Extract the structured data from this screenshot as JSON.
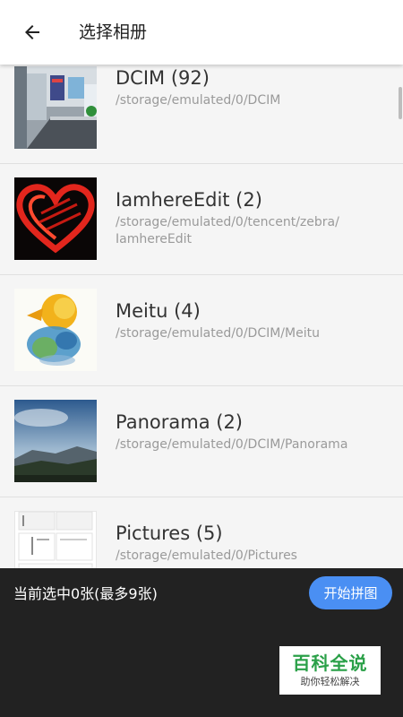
{
  "appbar": {
    "back_icon": "arrow-back-icon",
    "title": "选择相册"
  },
  "albums": [
    {
      "name": "DCIM (92)",
      "path": "/storage/emulated/0/DCIM",
      "thumb": "office-photo"
    },
    {
      "name": "IamhereEdit (2)",
      "path": "/storage/emulated/0/tencent/zebra/\nIamhereEdit",
      "thumb": "red-heart-image"
    },
    {
      "name": "Meitu (4)",
      "path": "/storage/emulated/0/DCIM/Meitu",
      "thumb": "watercolor-bird-image"
    },
    {
      "name": "Panorama (2)",
      "path": "/storage/emulated/0/DCIM/Panorama",
      "thumb": "panorama-landscape-photo"
    },
    {
      "name": "Pictures (5)",
      "path": "/storage/emulated/0/Pictures",
      "thumb": "screenshot-thumbnail"
    }
  ],
  "bottom_bar": {
    "selection_text": "当前选中0张(最多9张)",
    "start_button": "开始拼图"
  },
  "watermark": {
    "title": "百科全说",
    "subtitle": "助你轻松解决"
  },
  "colors": {
    "accent": "#4a8ff3",
    "bottom_panel": "#222222",
    "watermark_green": "#2aa048"
  }
}
